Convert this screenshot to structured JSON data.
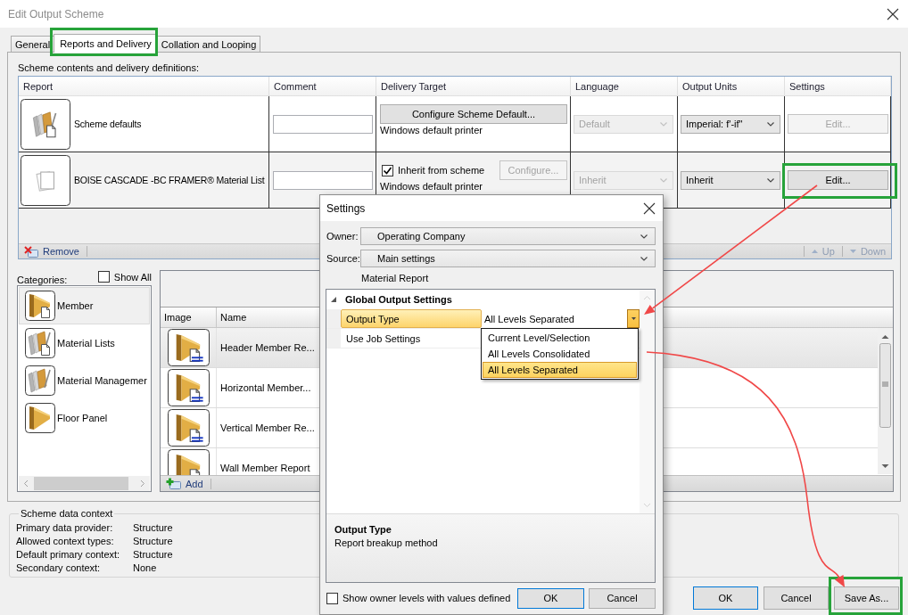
{
  "window": {
    "title": "Edit Output Scheme"
  },
  "tabs": [
    {
      "label": "General",
      "selected": false
    },
    {
      "label": "Reports and Delivery",
      "selected": true
    },
    {
      "label": "Collation and Looping",
      "selected": false
    }
  ],
  "reports": {
    "caption": "Scheme contents and delivery definitions:",
    "columns": [
      "Report",
      "Comment",
      "Delivery Target",
      "Language",
      "Output Units",
      "Settings"
    ],
    "rows": [
      {
        "kind": "lumberdoc",
        "name": "Scheme defaults",
        "selected": false,
        "delivery": {
          "kind": "button",
          "button": {
            "label": "Configure Scheme Default...",
            "disabled": false
          },
          "target": "Windows default printer"
        },
        "language": {
          "value": "Default",
          "disabled": true
        },
        "units": {
          "value": "Imperial: f'-if\"",
          "disabled": false
        },
        "settings": {
          "label": "Edit...",
          "disabled": true
        }
      },
      {
        "kind": "pages",
        "name": "BOISE CASCADE -BC FRAMER® Material List",
        "selected": true,
        "delivery": {
          "kind": "inherit",
          "checkbox": {
            "label": "Inherit from scheme",
            "checked": true
          },
          "button": {
            "label": "Configure...",
            "disabled": true
          },
          "target": "Windows default printer"
        },
        "language": {
          "value": "Inherit",
          "disabled": true
        },
        "units": {
          "value": "Inherit",
          "disabled": false
        },
        "settings": {
          "label": "Edit...",
          "disabled": false
        }
      }
    ],
    "toolbar": [
      {
        "kind": "remove",
        "label": "Remove",
        "disabled": false
      },
      {
        "kind": "up",
        "label": "Up",
        "disabled": true
      },
      {
        "kind": "down",
        "label": "Down",
        "disabled": true
      }
    ]
  },
  "categories": {
    "label": "Categories:",
    "show_all": {
      "label": "Show All",
      "checked": false
    },
    "items": [
      {
        "kind": "beamdoc",
        "label": "Member",
        "selected": true
      },
      {
        "kind": "lumberdoc",
        "label": "Material Lists",
        "selected": false
      },
      {
        "kind": "lumber",
        "label": "Material Managemer",
        "selected": false
      },
      {
        "kind": "beam",
        "label": "Floor Panel",
        "selected": false
      }
    ]
  },
  "templates": {
    "columns": [
      "Image",
      "Name"
    ],
    "rows": [
      {
        "name": "Header Member Re...",
        "selected": true
      },
      {
        "name": "Horizontal Member...",
        "selected": false
      },
      {
        "name": "Vertical Member Re...",
        "selected": false
      },
      {
        "name": "Wall Member Report",
        "selected": false
      }
    ],
    "toolbar": [
      {
        "kind": "add",
        "label": "Add",
        "disabled": false
      }
    ]
  },
  "context": {
    "title": "Scheme data context",
    "fields": [
      {
        "label": "Primary data provider:",
        "value": "Structure"
      },
      {
        "label": "Allowed context types:",
        "value": "Structure"
      },
      {
        "label": "Default primary context:",
        "value": "Structure"
      },
      {
        "label": "Secondary context:",
        "value": "None"
      }
    ]
  },
  "buttons": [
    {
      "label": "OK",
      "default": true
    },
    {
      "label": "Cancel",
      "default": false
    },
    {
      "label": "Save As...",
      "default": false
    }
  ],
  "settings_dialog": {
    "title": "Settings",
    "fields": [
      {
        "label": "Owner:",
        "value": "Operating Company"
      },
      {
        "label": "Source:",
        "value": "Main settings"
      }
    ],
    "subtitle": "Material Report",
    "category": {
      "label": "Global Output Settings",
      "expanded": true
    },
    "properties": [
      {
        "name": "Output Type",
        "value": "All Levels Separated",
        "selected": true,
        "open": true,
        "options": [
          {
            "label": "Current Level/Selection",
            "selected": false
          },
          {
            "label": "All Levels Consolidated",
            "selected": false
          },
          {
            "label": "All Levels Separated",
            "selected": true
          }
        ]
      },
      {
        "name": "Use Job Settings",
        "selected": false,
        "open": false
      }
    ],
    "description": {
      "title": "Output Type",
      "text": "Report breakup method"
    },
    "show_owner_levels": {
      "label": "Show owner levels with values defined",
      "checked": false
    },
    "buttons": [
      {
        "label": "OK",
        "default": true
      },
      {
        "label": "Cancel",
        "default": false
      }
    ]
  }
}
